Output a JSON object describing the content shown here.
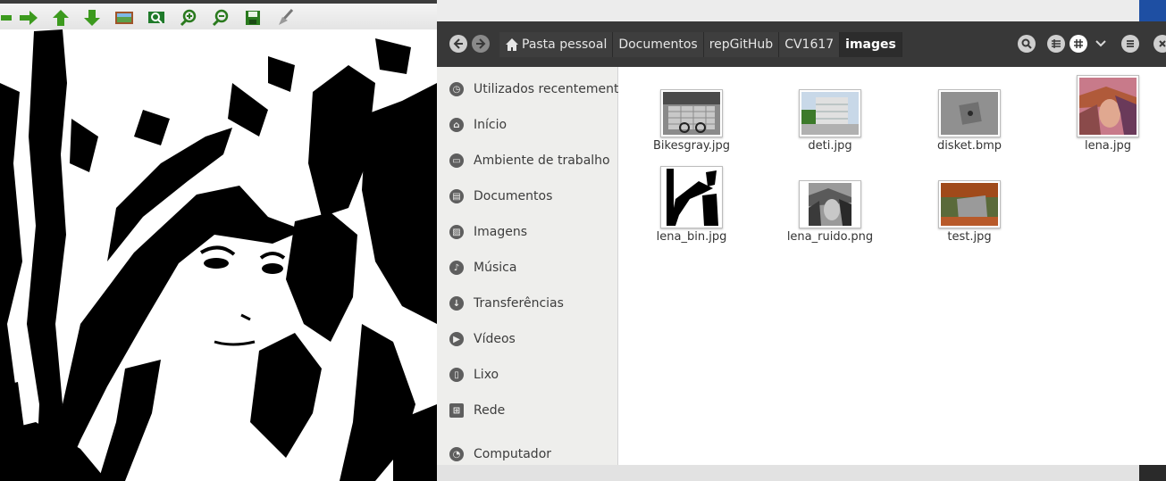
{
  "viewer": {
    "toolbar_icons": [
      "arrow-left-icon",
      "arrow-right-icon",
      "arrow-up-icon",
      "arrow-down-icon",
      "image-icon",
      "zoom-fit-icon",
      "zoom-in-icon",
      "zoom-out-icon",
      "save-icon",
      "clear-icon"
    ]
  },
  "file_manager": {
    "breadcrumbs": [
      "Pasta pessoal",
      "Documentos",
      "repGitHub",
      "CV1617",
      "images"
    ],
    "sidebar": [
      {
        "label": "Utilizados recentemente",
        "icon": "recent-icon"
      },
      {
        "label": "Início",
        "icon": "home-icon"
      },
      {
        "label": "Ambiente de trabalho",
        "icon": "desktop-icon"
      },
      {
        "label": "Documentos",
        "icon": "documents-icon"
      },
      {
        "label": "Imagens",
        "icon": "pictures-icon"
      },
      {
        "label": "Música",
        "icon": "music-icon"
      },
      {
        "label": "Transferências",
        "icon": "downloads-icon"
      },
      {
        "label": "Vídeos",
        "icon": "videos-icon"
      },
      {
        "label": "Lixo",
        "icon": "trash-icon"
      },
      {
        "label": "Rede",
        "icon": "network-icon"
      },
      {
        "label": "Computador",
        "icon": "computer-icon"
      }
    ],
    "files": [
      {
        "name": "Bikesgray.jpg"
      },
      {
        "name": "deti.jpg"
      },
      {
        "name": "disket.bmp"
      },
      {
        "name": "lena.jpg"
      },
      {
        "name": "lena_bin.jpg"
      },
      {
        "name": "lena_ruido.png"
      },
      {
        "name": "test.jpg"
      }
    ]
  }
}
